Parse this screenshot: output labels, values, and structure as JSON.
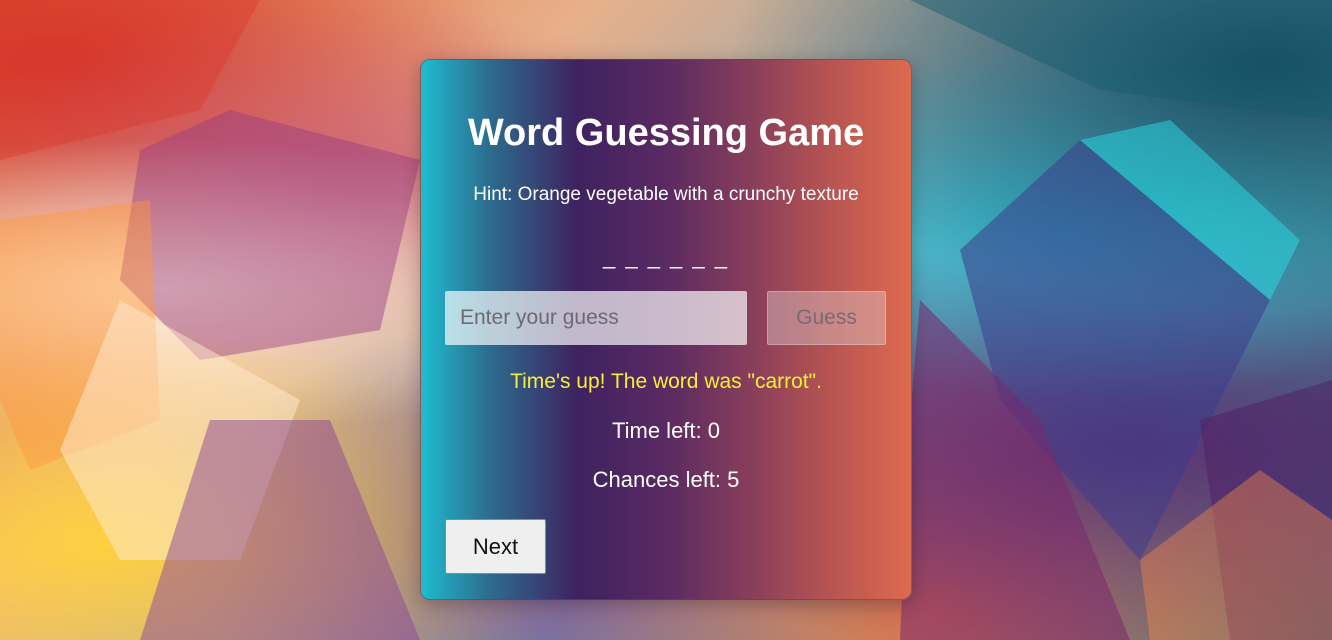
{
  "game": {
    "title": "Word Guessing Game",
    "hint": "Hint: Orange vegetable with a crunchy texture",
    "blanks": "_ _ _ _ _ _",
    "input_placeholder": "Enter your guess",
    "input_value": "",
    "guess_label": "Guess",
    "message": "Time's up! The word was \"carrot\".",
    "time_left": "Time left: 0",
    "chances_left": "Chances left: 5",
    "next_label": "Next"
  },
  "colors": {
    "message": "#f5ef3a",
    "text": "#ffffff",
    "card_gradient": [
      "#1fbcd0",
      "#3f2260",
      "#de6a4e"
    ]
  }
}
